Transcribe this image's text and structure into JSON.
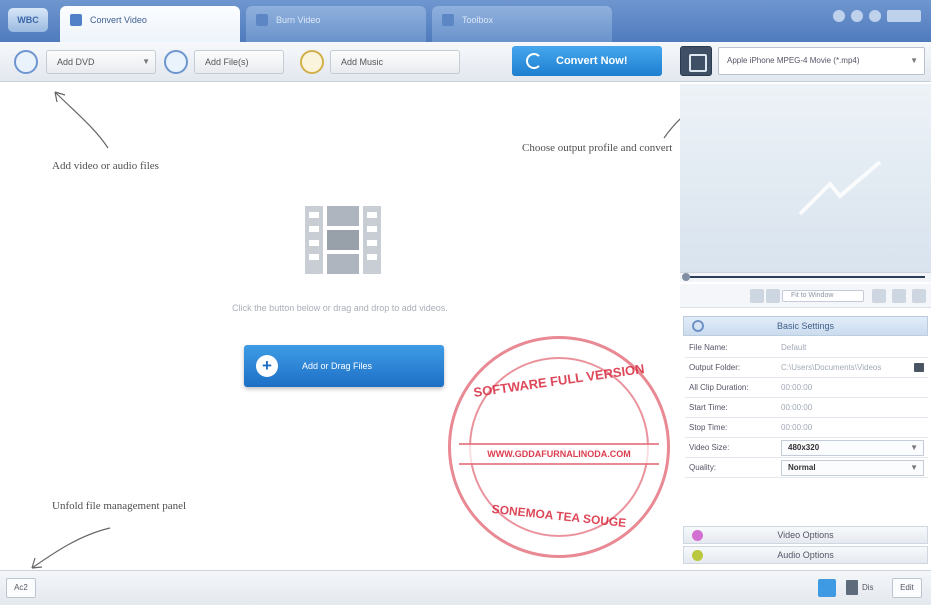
{
  "app": {
    "logo": "WBC"
  },
  "tabs": [
    {
      "label": "Convert Video",
      "icon": "convert-icon",
      "active": true
    },
    {
      "label": "Burn Video",
      "icon": "disc-icon",
      "active": false
    },
    {
      "label": "Toolbox",
      "icon": "toolbox-icon",
      "active": false
    }
  ],
  "toolbar": {
    "add_dvd": "Add DVD",
    "add_files": "Add File(s)",
    "add_music": "Add Music",
    "convert_now": "Convert Now!",
    "output_profile": "Apple iPhone MPEG-4 Movie (*.mp4)"
  },
  "annotations": {
    "add_files": "Add video or audio files",
    "output": "Choose output profile and convert",
    "unfold": "Unfold file management panel"
  },
  "empty_state": {
    "hint": "Click the button below or drag and drop to add videos.",
    "add_button": "Add or Drag Files"
  },
  "preview": {
    "zoom_value": "Fit to Window"
  },
  "basic_settings": {
    "title": "Basic Settings",
    "rows": [
      {
        "label": "File Name:",
        "value": "Default"
      },
      {
        "label": "Output Folder:",
        "value": "C:\\Users\\Documents\\Videos"
      },
      {
        "label": "All Clip Duration:",
        "value": "00:00:00"
      },
      {
        "label": "Start Time:",
        "value": "00:00:00"
      },
      {
        "label": "Stop Time:",
        "value": "00:00:00"
      },
      {
        "label": "Video Size:",
        "value": "480x320"
      },
      {
        "label": "Quality:",
        "value": "Normal"
      }
    ]
  },
  "options": {
    "video": "Video Options",
    "audio": "Audio Options"
  },
  "statusbar": {
    "unfold": "Ac2",
    "right_label": "Dis",
    "right_btn": "Edit"
  },
  "watermark": {
    "top": "SOFTWARE FULL VERSION",
    "url": "WWW.GDDAFURNALINODA.COM",
    "bottom": "SONEMOA TEA SOUGE"
  },
  "colors": {
    "accent": "#1d7fcf",
    "title_bar": "#5b86c6",
    "stamp": "#d7283c"
  }
}
